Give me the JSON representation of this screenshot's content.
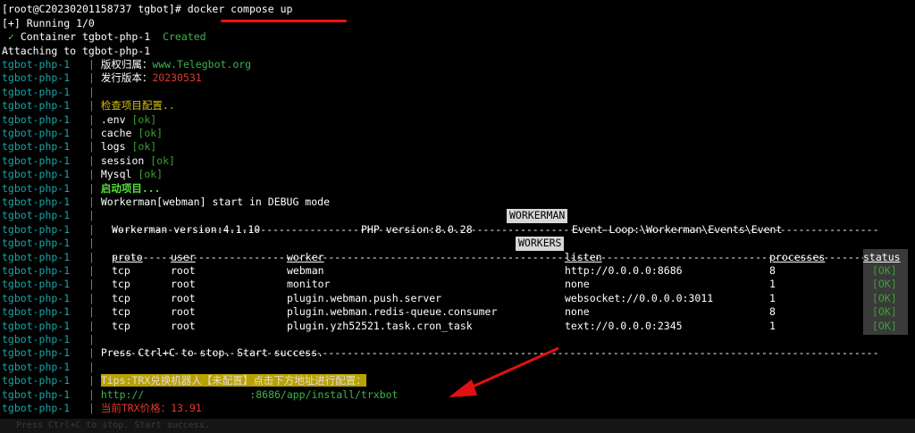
{
  "prompt": {
    "userhost": "[root@C20230201158737 tgbot]# ",
    "command": "docker compose up"
  },
  "status_lines": {
    "running": "[+] Running 1/0",
    "check": "✓",
    "container": "Container tgbot-php-1",
    "created": "Created",
    "attaching": "Attaching to tgbot-php-1"
  },
  "prefix": "tgbot-php-1",
  "separator": "|",
  "info": {
    "copyright_label": "版权归属：",
    "copyright_value": "www.Telegbot.org",
    "version_label": "发行版本：",
    "version_value": "20230531",
    "check_title": "检查项目配置..",
    "checks": [
      {
        "name": ".env",
        "status": "[ok]"
      },
      {
        "name": "cache",
        "status": "[ok]"
      },
      {
        "name": "logs",
        "status": "[ok]"
      },
      {
        "name": "session",
        "status": "[ok]"
      },
      {
        "name": "Mysql",
        "status": "[ok]"
      }
    ],
    "start_title": "启动项目...",
    "debug_line": "Workerman[webman] start in DEBUG mode"
  },
  "workerman": {
    "banner": "WORKERMAN",
    "version": "Workerman version:4.1.10",
    "php": "PHP version:8.0.28",
    "loop": "Event-Loop:\\Workerman\\Events\\Event"
  },
  "workers": {
    "banner": "WORKERS",
    "headers": [
      "proto",
      "user",
      "worker",
      "listen",
      "processes",
      "status"
    ],
    "rows": [
      [
        "tcp",
        "root",
        "webman",
        "http://0.0.0.0:8686",
        "8",
        "[OK]"
      ],
      [
        "tcp",
        "root",
        "monitor",
        "none",
        "1",
        "[OK]"
      ],
      [
        "tcp",
        "root",
        "plugin.webman.push.server",
        "websocket://0.0.0.0:3011",
        "1",
        "[OK]"
      ],
      [
        "tcp",
        "root",
        "plugin.webman.redis-queue.consumer",
        "none",
        "8",
        "[OK]"
      ],
      [
        "tcp",
        "root",
        "plugin.yzh52521.task.cron_task",
        "text://0.0.0.0:2345",
        "1",
        "[OK]"
      ]
    ]
  },
  "footer": {
    "stop_msg": "Press Ctrl+C to stop. Start success.",
    "tips": "Tips:TRX兑换机器人【未配置】点击下方地址进行配置：",
    "url_start": "http://",
    "url_end": ":8686/app/install/trxbot",
    "price": "当前TRX价格：13.91"
  },
  "bottom_ghost": "Press Ctrl+C to stop. Start success.",
  "colors": {
    "annotation": "#e11111",
    "tips_bg": "#b8a200",
    "accent_cyan": "#19a6a6"
  }
}
